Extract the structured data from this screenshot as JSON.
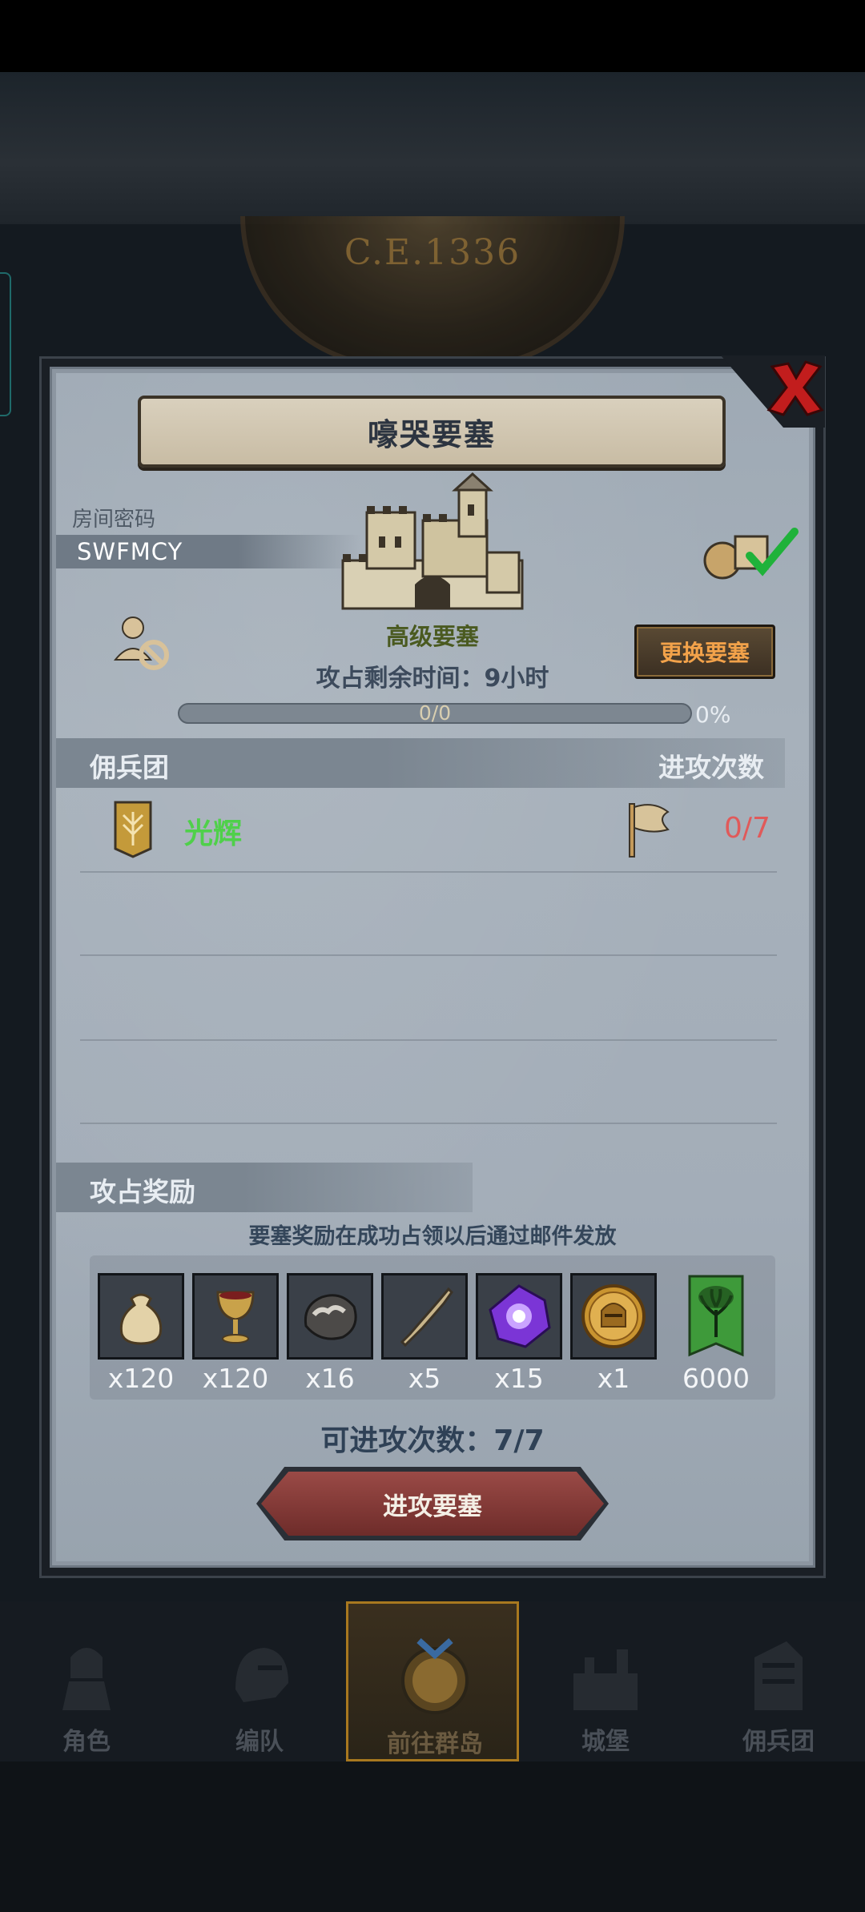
{
  "background": {
    "era": "C.E.1336"
  },
  "dialog": {
    "title": "嚎哭要塞",
    "room_label": "房间密码",
    "room_code": "SWFMCY",
    "fortress_level": "高级要塞",
    "change_button": "更换要塞",
    "time_left": "攻占剩余时间：9小时",
    "progress": {
      "text": "0/0",
      "percent_text": "0%",
      "fraction": 0
    },
    "guild_section": {
      "title": "佣兵团",
      "right_title": "进攻次数"
    },
    "guild": {
      "name": "光辉",
      "attacks": "0/7"
    },
    "rewards_section": {
      "title": "攻占奖励"
    },
    "reward_note": "要塞奖励在成功占领以后通过邮件发放",
    "rewards": [
      {
        "icon": "money-bag-icon",
        "qty": "x120"
      },
      {
        "icon": "goblet-icon",
        "qty": "x120"
      },
      {
        "icon": "ore-icon",
        "qty": "x16"
      },
      {
        "icon": "horn-icon",
        "qty": "x5"
      },
      {
        "icon": "purple-crystal-icon",
        "qty": "x15"
      },
      {
        "icon": "knight-coin-icon",
        "qty": "x1"
      },
      {
        "icon": "guild-banner-icon",
        "qty": "6000"
      }
    ],
    "attempts": "可进攻次数：7/7",
    "attack_button": "进攻要塞"
  },
  "nav": [
    {
      "label": "角色",
      "icon": "knight-icon"
    },
    {
      "label": "编队",
      "icon": "helmet-icon"
    },
    {
      "label": "前往群岛",
      "icon": "island-icon",
      "active": true
    },
    {
      "label": "城堡",
      "icon": "castle-icon"
    },
    {
      "label": "佣兵团",
      "icon": "mercenary-icon"
    }
  ],
  "colors": {
    "guild_name": "#4fd04a",
    "attack_count": "#e05a5a",
    "change_button_text": "#f2a24a",
    "fortress_level": "#4a5a20"
  }
}
